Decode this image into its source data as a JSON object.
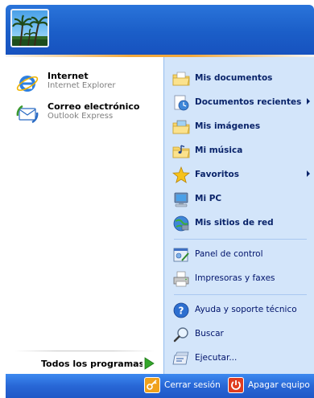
{
  "pinned": [
    {
      "title": "Internet",
      "subtitle": "Internet Explorer",
      "icon": "internet-explorer-icon"
    },
    {
      "title": "Correo electrónico",
      "subtitle": "Outlook Express",
      "icon": "outlook-express-icon"
    }
  ],
  "all_programs": {
    "label": "Todos los programas",
    "icon": "green-arrow-icon"
  },
  "right_items": [
    {
      "label": "Mis documentos",
      "icon": "documents-folder-icon"
    },
    {
      "label": "Documentos recientes",
      "icon": "recent-documents-icon"
    },
    {
      "label": "Mis imágenes",
      "icon": "pictures-folder-icon"
    },
    {
      "label": "Mi música",
      "icon": "music-folder-icon"
    },
    {
      "label": "Favoritos",
      "icon": "favorites-star-icon"
    },
    {
      "label": "Mi PC",
      "icon": "computer-icon"
    },
    {
      "label": "Mis sitios de red",
      "icon": "network-icon"
    },
    {
      "label": "Panel de control",
      "icon": "control-panel-icon"
    },
    {
      "label": "Impresoras y faxes",
      "icon": "printer-icon"
    },
    {
      "label": "Ayuda y soporte técnico",
      "icon": "help-icon"
    },
    {
      "label": "Buscar",
      "icon": "search-icon"
    },
    {
      "label": "Ejecutar...",
      "icon": "run-icon"
    }
  ],
  "footer": {
    "logoff_label": "Cerrar sesión",
    "shutdown_label": "Apagar equipo"
  },
  "colors": {
    "header_blue": "#1b5ec8",
    "right_pane": "#d3e5fa",
    "accent_orange": "#f2a83c",
    "shutdown_red": "#e03c1f"
  }
}
